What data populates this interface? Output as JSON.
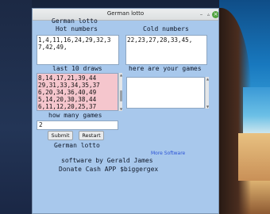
{
  "window": {
    "title": "German lotto"
  },
  "app": {
    "heading": "German lotto",
    "hot_label": "Hot numbers",
    "hot_value": "1,4,11,16,24,29,32,37,42,49,",
    "cold_label": "Cold numbers",
    "cold_value": "22,23,27,28,33,45,",
    "draws_label": "last 10 draws",
    "draws": [
      "8,14,17,21,39,44",
      "29,31,33,34,35,37",
      "6,20,34,36,40,49",
      "5,14,20,30,38,44",
      "6,11,12,20,25,37"
    ],
    "games_label": "here are your games",
    "games_value": "",
    "how_many_label": "how many games",
    "how_many_value": "2",
    "submit_label": "Submit",
    "restart_label": "Restart",
    "footer_title": "German lotto",
    "more_software": "More Software",
    "credit_line": "software by   Gerald James",
    "donate_line": "Donate Cash APP   $biggergex"
  },
  "colors": {
    "window_bg": "#a8c8ec",
    "draws_bg": "#f5c6cd",
    "link": "#2d55d6",
    "close_button": "#51a441"
  }
}
